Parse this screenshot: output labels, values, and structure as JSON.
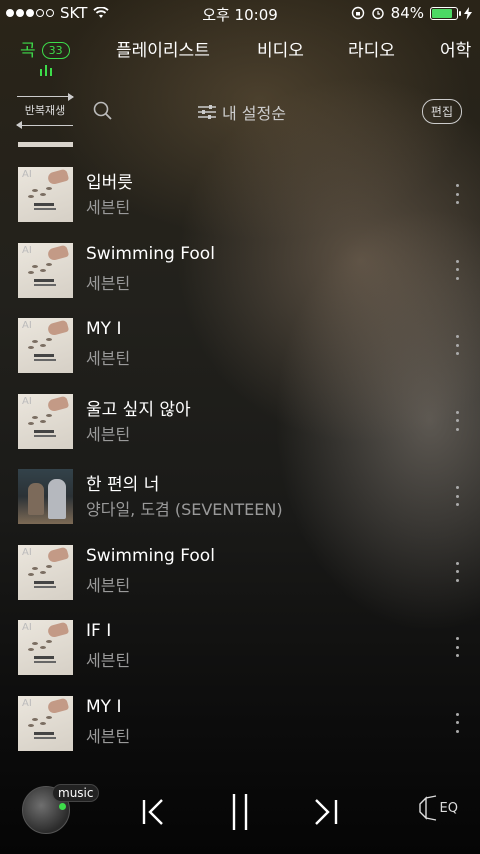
{
  "status_bar": {
    "carrier": "SKT",
    "time": "오후 10:09",
    "battery_percent": "84%",
    "battery_level": 0.84,
    "signal_bars_filled": 3,
    "signal_bars_total": 5
  },
  "tabs": [
    {
      "label": "곡",
      "badge": "33",
      "active": true
    },
    {
      "label": "플레이리스트",
      "active": false
    },
    {
      "label": "비디오",
      "active": false
    },
    {
      "label": "라디오",
      "active": false
    },
    {
      "label": "어학",
      "active": false
    }
  ],
  "toolbar": {
    "repeat_label": "반복재생",
    "sort_label": "내 설정순",
    "edit_label": "편집"
  },
  "songs": [
    {
      "title": "입버릇",
      "artist": "세븐틴",
      "cover": "seventeen"
    },
    {
      "title": "Swimming Fool",
      "artist": "세븐틴",
      "cover": "seventeen"
    },
    {
      "title": "MY I",
      "artist": "세븐틴",
      "cover": "seventeen"
    },
    {
      "title": "울고 싶지 않아",
      "artist": "세븐틴",
      "cover": "seventeen"
    },
    {
      "title": "한 편의 너",
      "artist": "양다일, 도겸 (SEVENTEEN)",
      "cover": "duo"
    },
    {
      "title": "Swimming Fool",
      "artist": "세븐틴",
      "cover": "seventeen"
    },
    {
      "title": "IF I",
      "artist": "세븐틴",
      "cover": "seventeen"
    },
    {
      "title": "MY I",
      "artist": "세븐틴",
      "cover": "seventeen"
    }
  ],
  "player": {
    "tag": "music",
    "eq_label": "EQ"
  },
  "colors": {
    "accent": "#3ddc4a",
    "secondary_text": "#9a9a9a"
  }
}
